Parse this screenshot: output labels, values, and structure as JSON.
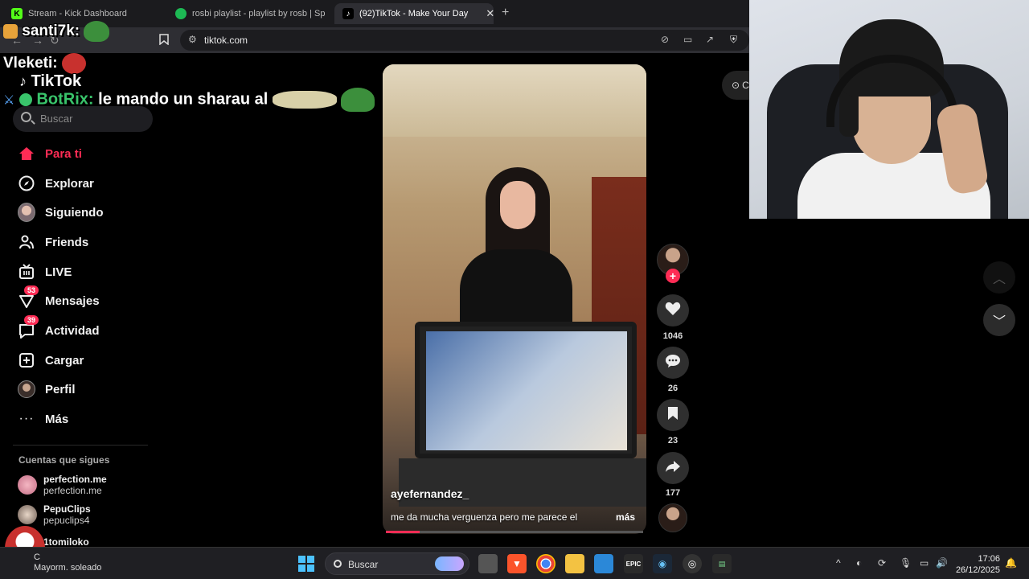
{
  "browser": {
    "tabs": [
      {
        "title": "Stream - Kick Dashboard",
        "favicon": "K"
      },
      {
        "title": "rosbi playlist - playlist by rosb | Spot",
        "favicon": "spotify"
      },
      {
        "title": "(92)TikTok - Make Your Day",
        "favicon": "tiktok"
      }
    ],
    "url": "tiktok.com"
  },
  "chat": {
    "line1_user": "santi7k:",
    "line2_user": "Vleketi:",
    "line3_user": "BotRix:",
    "line3_message": "le mando un sharau al"
  },
  "tiktok": {
    "logo": "TikTok",
    "search_placeholder": "Buscar",
    "nav": [
      {
        "label": "Para ti",
        "icon": "home-icon",
        "active": true
      },
      {
        "label": "Explorar",
        "icon": "compass-icon"
      },
      {
        "label": "Siguiendo",
        "icon": "following-avatar-icon"
      },
      {
        "label": "Friends",
        "icon": "friends-icon"
      },
      {
        "label": "LIVE",
        "icon": "live-tv-icon"
      },
      {
        "label": "Mensajes",
        "icon": "messages-icon",
        "badge": "53"
      },
      {
        "label": "Actividad",
        "icon": "activity-icon",
        "badge": "39"
      },
      {
        "label": "Cargar",
        "icon": "upload-icon"
      },
      {
        "label": "Perfil",
        "icon": "profile-avatar-icon"
      },
      {
        "label": "Más",
        "icon": "more-dots-icon"
      }
    ],
    "following_title": "Cuentas que sigues",
    "following": [
      {
        "name": "perfection.me",
        "handle": "perfection.me"
      },
      {
        "name": "PepuClips",
        "handle": "pepuclips4"
      },
      {
        "name": "1tomiloko",
        "handle": ""
      }
    ],
    "video": {
      "username": "ayefernandez_",
      "description": "me da mucha verguenza pero me parece el",
      "more": "más",
      "progress": 0.13
    },
    "actions": {
      "likes": "1046",
      "comments": "26",
      "saves": "23",
      "shares": "177"
    },
    "coins_label": "C"
  },
  "taskbar": {
    "weather_temp": "C",
    "weather_desc": "Mayorm. soleado",
    "search": "Buscar",
    "time": "17:06",
    "date": "26/12/2025"
  },
  "colors": {
    "accent": "#fe2c55",
    "background": "#000000"
  }
}
